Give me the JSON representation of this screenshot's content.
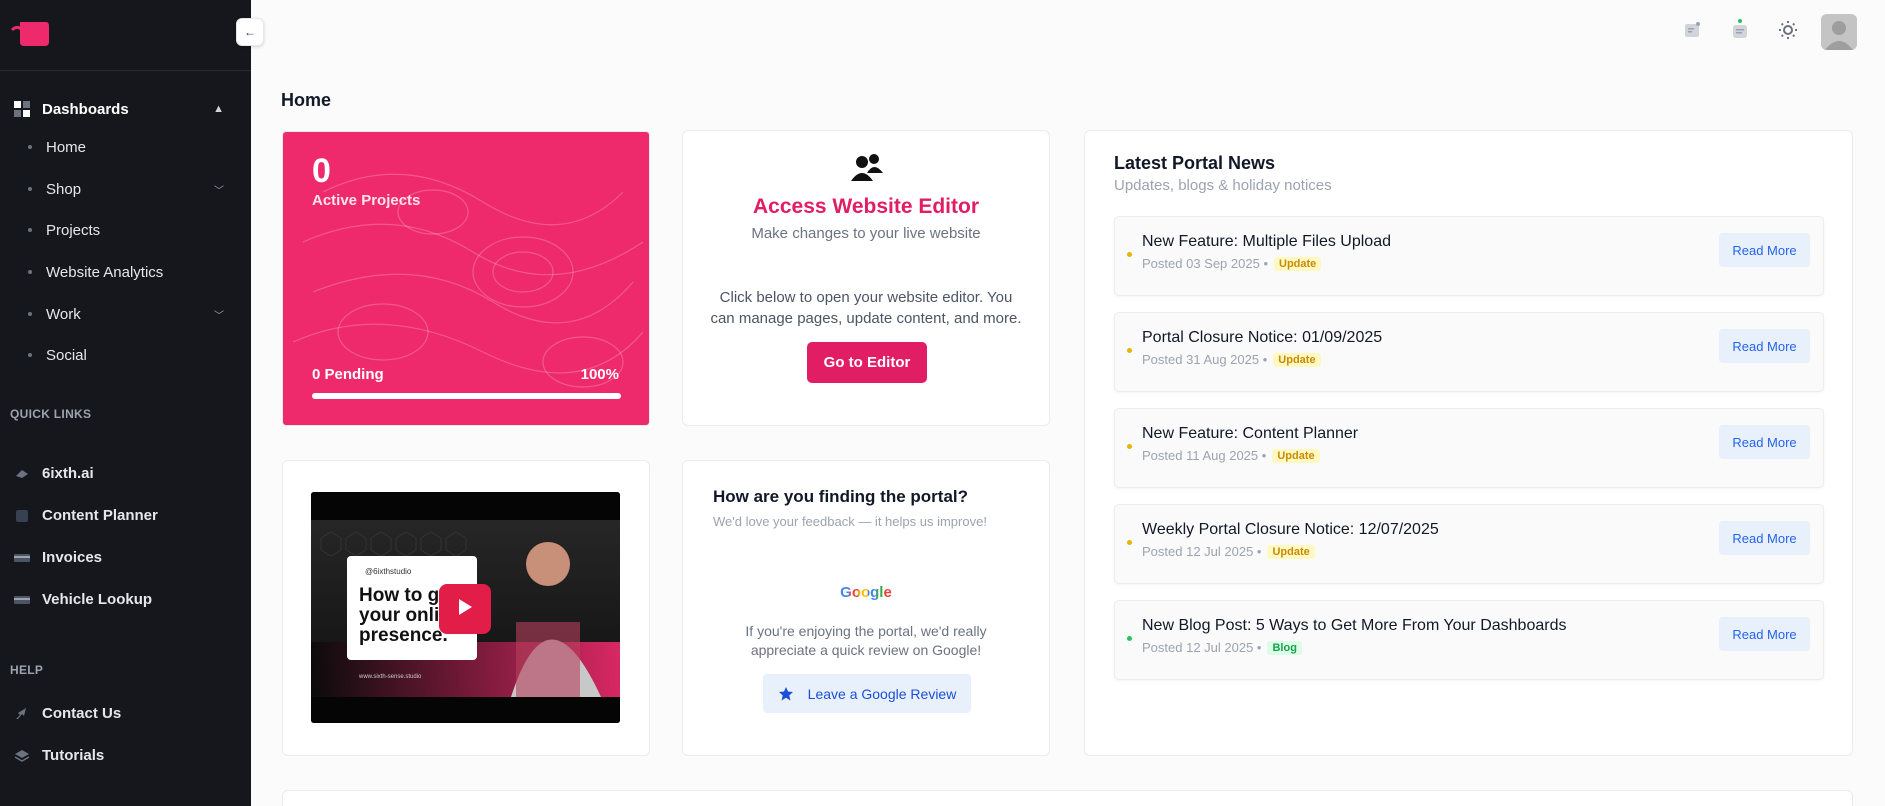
{
  "sidebar": {
    "dashboards_label": "Dashboards",
    "items": [
      {
        "label": "Home",
        "has_children": false
      },
      {
        "label": "Shop",
        "has_children": true
      },
      {
        "label": "Projects",
        "has_children": false
      },
      {
        "label": "Website Analytics",
        "has_children": false
      },
      {
        "label": "Work",
        "has_children": true
      },
      {
        "label": "Social",
        "has_children": false
      }
    ],
    "quick_links_label": "QUICK LINKS",
    "quick_links": [
      {
        "label": "6ixth.ai",
        "icon": "ai-icon"
      },
      {
        "label": "Content Planner",
        "icon": "planner-icon"
      },
      {
        "label": "Invoices",
        "icon": "card-icon"
      },
      {
        "label": "Vehicle Lookup",
        "icon": "card-icon"
      }
    ],
    "help_label": "HELP",
    "help_links": [
      {
        "label": "Contact Us",
        "icon": "rocket-icon"
      },
      {
        "label": "Tutorials",
        "icon": "layers-icon"
      }
    ]
  },
  "page": {
    "title": "Home"
  },
  "projects": {
    "count": "0",
    "label": "Active Projects",
    "pending": "0 Pending",
    "percent_text": "100%",
    "progress": 1.0
  },
  "editor": {
    "title": "Access Website Editor",
    "subtitle": "Make changes to your live website",
    "description": "Click below to open your website editor. You can manage pages, update content, and more.",
    "button": "Go to Editor"
  },
  "video": {
    "handle": "@6ixthstudio",
    "headline_1": "How to g",
    "headline_2": "your onli",
    "headline_3": "presence.",
    "url": "www.sixth-sense.studio"
  },
  "feedback": {
    "title": "How are you finding the portal?",
    "subtitle": "We'd love your feedback — it helps us improve!",
    "google_logo": "Google",
    "description": "If you're enjoying the portal, we'd really appreciate a quick review on Google!",
    "button": "Leave a Google Review"
  },
  "news": {
    "title": "Latest Portal News",
    "subtitle": "Updates, blogs & holiday notices",
    "read_more": "Read More",
    "items": [
      {
        "title": "New Feature: Multiple Files Upload",
        "date": "Posted 03 Sep 2025",
        "tag": "Update",
        "color": "#eab308"
      },
      {
        "title": "Portal Closure Notice: 01/09/2025",
        "date": "Posted 31 Aug 2025",
        "tag": "Update",
        "color": "#eab308"
      },
      {
        "title": "New Feature: Content Planner",
        "date": "Posted 11 Aug 2025",
        "tag": "Update",
        "color": "#eab308"
      },
      {
        "title": "Weekly Portal Closure Notice: 12/07/2025",
        "date": "Posted 12 Jul 2025",
        "tag": "Update",
        "color": "#eab308"
      },
      {
        "title": "New Blog Post: 5 Ways to Get More From Your Dashboards",
        "date": "Posted 12 Jul 2025",
        "tag": "Blog",
        "color": "#22c55e"
      }
    ]
  },
  "colors": {
    "brand": "#ee2a6c",
    "sidebar": "#15171c",
    "link": "#2563eb"
  }
}
